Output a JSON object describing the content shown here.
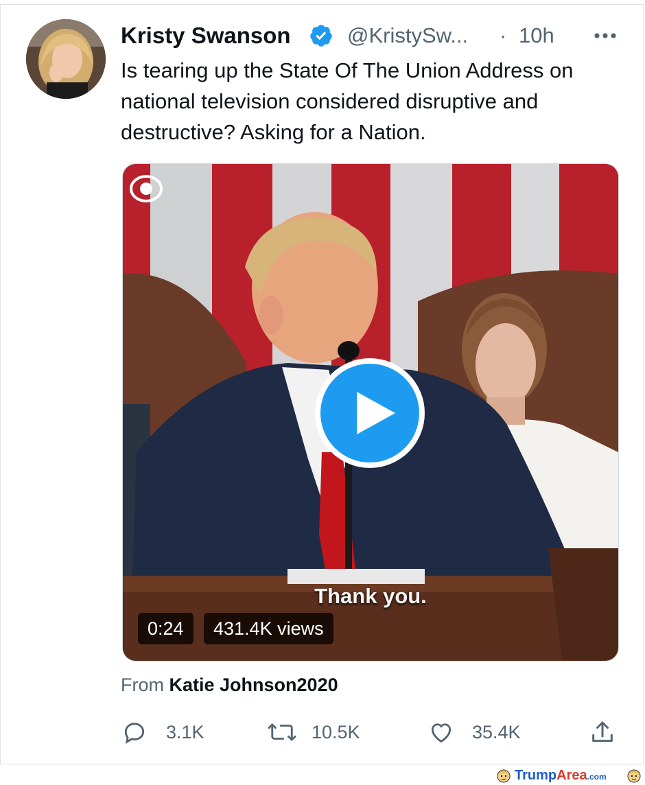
{
  "tweet": {
    "display_name": "Kristy Swanson",
    "handle": "@KristySw...",
    "separator": "·",
    "time": "10h",
    "text": "Is tearing up the State Of The Union Address on national television considered disruptive and destructive? Asking for a Nation.",
    "verified_color": "#1d9bf0"
  },
  "media": {
    "caption": "Thank you.",
    "duration": "0:24",
    "views": "431.4K views"
  },
  "attribution": {
    "prefix": "From",
    "source": "Katie Johnson2020"
  },
  "actions": {
    "reply_count": "3.1K",
    "retweet_count": "10.5K",
    "like_count": "35.4K"
  },
  "watermark": {
    "part1": "Trump",
    "part2": "Area",
    "suffix": ".com"
  },
  "icons": [
    "verified-badge-icon",
    "more-icon",
    "cbs-eye-icon",
    "play-icon",
    "reply-icon",
    "retweet-icon",
    "like-icon",
    "share-icon"
  ]
}
